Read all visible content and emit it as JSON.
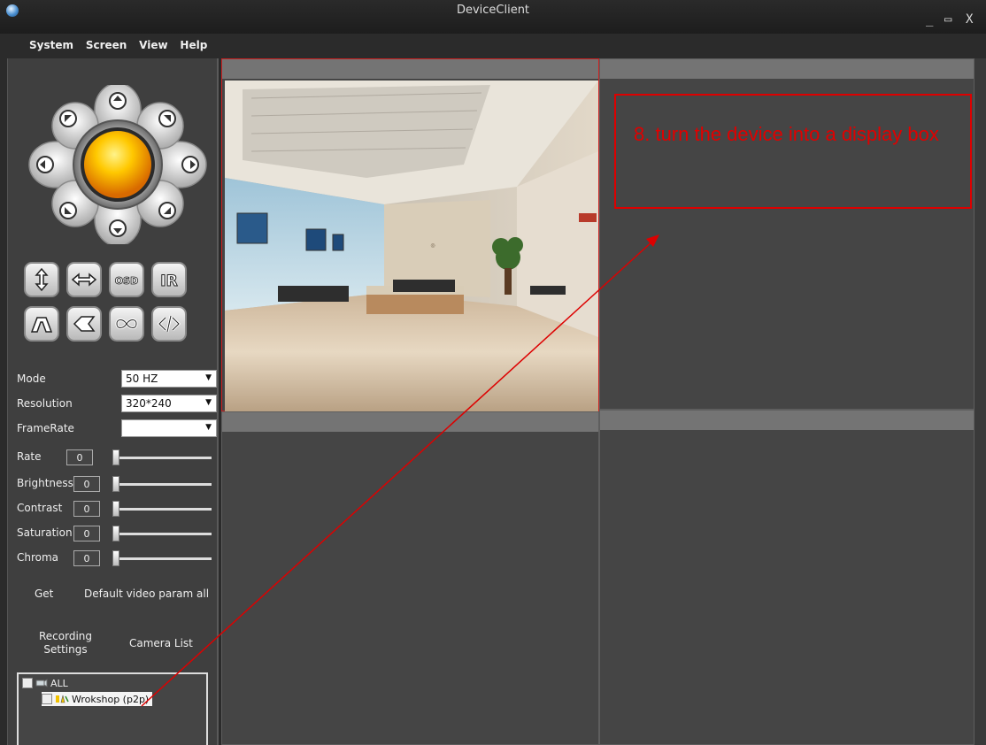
{
  "window": {
    "title": "DeviceClient",
    "minimize": "_",
    "maximize": "▭",
    "close": "X"
  },
  "menu": [
    "System",
    "Screen",
    "View",
    "Help"
  ],
  "ptz": {
    "icon": "ptz-direction-pad",
    "buttons_row1": [
      "flip-vertical-icon",
      "flip-horizontal-icon",
      "osd-icon",
      "ir-icon"
    ],
    "buttons_row2": [
      "zoom-in-icon",
      "zoom-out-icon",
      "patrol-icon",
      "code-icon"
    ],
    "osd_label": "OSD",
    "ir_label": "IR"
  },
  "params": {
    "mode": {
      "label": "Mode",
      "value": "50 HZ"
    },
    "resolution": {
      "label": "Resolution",
      "value": "320*240"
    },
    "framerate": {
      "label": "FrameRate",
      "value": ""
    },
    "rate": {
      "label": "Rate",
      "value": "0"
    },
    "brightness": {
      "label": "Brightness",
      "value": "0"
    },
    "contrast": {
      "label": "Contrast",
      "value": "0"
    },
    "saturation": {
      "label": "Saturation",
      "value": "0"
    },
    "chroma": {
      "label": "Chroma",
      "value": "0"
    }
  },
  "actions": {
    "get": "Get",
    "default_all": "Default video param all",
    "recording_line1": "Recording",
    "recording_line2": "Settings",
    "camera_list": "Camera List"
  },
  "tree": {
    "root": "ALL",
    "device": "Wrokshop (p2p)"
  },
  "annotation": {
    "text": "8. turn the device into a display box",
    "color": "#e00000"
  },
  "colors": {
    "annotation": "#dd0000",
    "selected_pane_border": "#cc2222"
  }
}
